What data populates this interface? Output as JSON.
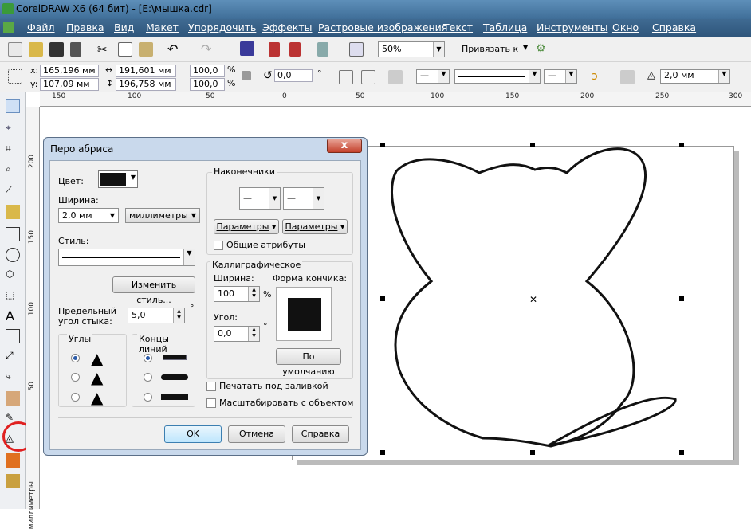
{
  "app": {
    "title": "CorelDRAW X6 (64 бит) - [E:\\мышка.cdr]"
  },
  "menu": [
    "Файл",
    "Правка",
    "Вид",
    "Макет",
    "Упорядочить",
    "Эффекты",
    "Растровые изображения",
    "Текст",
    "Таблица",
    "Инструменты",
    "Окно",
    "Справка"
  ],
  "toolbar": {
    "zoom": "50%",
    "snap": "Привязать к"
  },
  "props": {
    "x": "165,196 мм",
    "y": "107,09 мм",
    "w": "191,601 мм",
    "h": "196,758 мм",
    "sx": "100,0",
    "sy": "100,0",
    "pct": "%",
    "rot": "0,0",
    "deg": "°",
    "outline": "2,0 мм"
  },
  "hruler": [
    "150",
    "100",
    "50",
    "0",
    "50",
    "100",
    "150",
    "200",
    "250",
    "300"
  ],
  "vruler": [
    "200",
    "150",
    "100",
    "50"
  ],
  "vruler_unit": "миллиметры",
  "dialog": {
    "title": "Перо абриса",
    "close": "x",
    "color_label": "Цвет:",
    "color": "#111111",
    "width_label": "Ширина:",
    "width_value": "2,0 мм",
    "units": "миллиметры",
    "style_label": "Стиль:",
    "edit_style": "Изменить стиль...",
    "miter_label1": "Предельный",
    "miter_label2": "угол стыка:",
    "miter_value": "5,0",
    "deg": "°",
    "corners_label": "Углы",
    "linecaps_label": "Концы линий",
    "arrows_label": "Наконечники",
    "params1": "Параметры",
    "params2": "Параметры",
    "shared": "Общие атрибуты",
    "callig_label": "Каллиграфическое",
    "cw_label": "Ширина:",
    "cw_value": "100",
    "pct": "%",
    "nib_label": "Форма кончика:",
    "angle_label": "Угол:",
    "angle_value": "0,0",
    "default": "По умолчанию",
    "behind_fill": "Печатать под заливкой",
    "scale": "Масштабировать с объектом",
    "ok": "OK",
    "cancel": "Отмена",
    "help": "Справка"
  }
}
